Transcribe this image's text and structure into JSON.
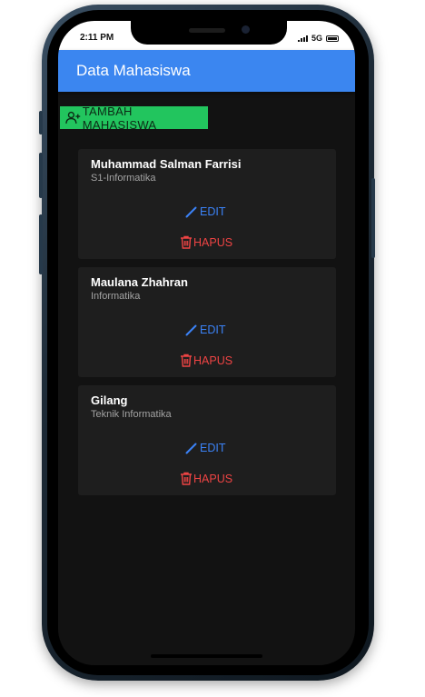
{
  "status_bar": {
    "time": "2:11 PM",
    "network": "5G"
  },
  "app_bar": {
    "title": "Data Mahasiswa",
    "color": "#3b86f0"
  },
  "add_button": {
    "label": "TAMBAH MAHASISWA",
    "icon": "add-user-icon",
    "color": "#22c55e"
  },
  "students": [
    {
      "name": "Muhammad Salman Farrisi",
      "program": "S1-Informatika",
      "edit_label": "EDIT",
      "delete_label": "HAPUS"
    },
    {
      "name": "Maulana Zhahran",
      "program": "Informatika",
      "edit_label": "EDIT",
      "delete_label": "HAPUS"
    },
    {
      "name": "Gilang",
      "program": "Teknik Informatika",
      "edit_label": "EDIT",
      "delete_label": "HAPUS"
    }
  ],
  "icons": {
    "edit": "pencil-icon",
    "delete": "trash-icon"
  },
  "colors": {
    "background": "#121212",
    "card": "#1e1e1e",
    "edit": "#3b82f6",
    "delete": "#ef4444"
  }
}
